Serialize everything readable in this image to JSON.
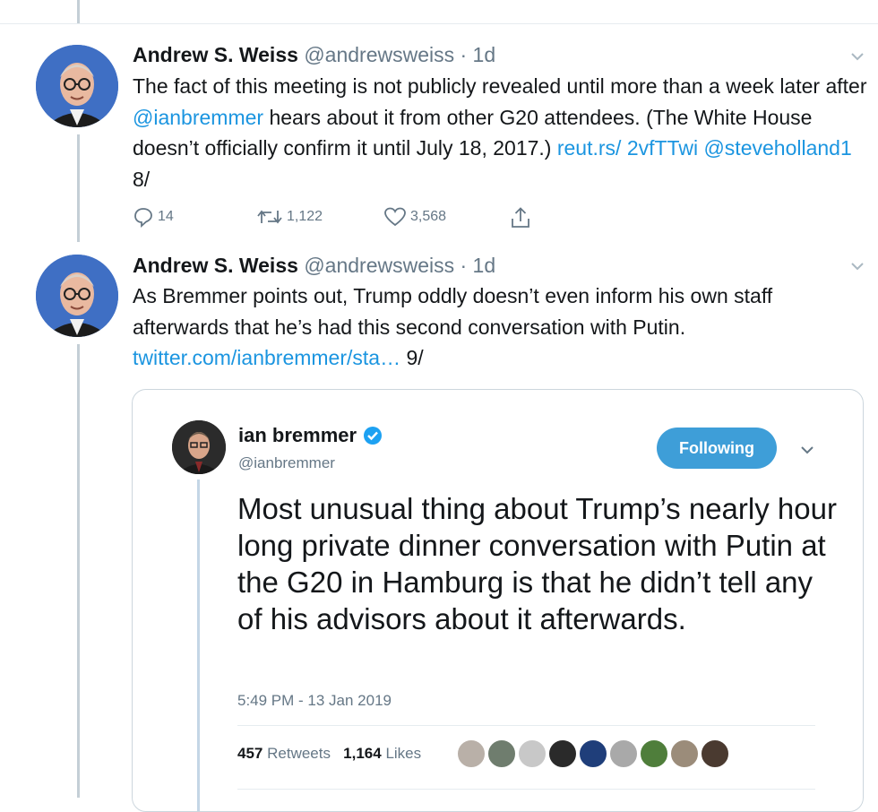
{
  "tweets": [
    {
      "name": "Andrew S. Weiss",
      "handle": "@andrewsweiss",
      "time": "· 1d",
      "text_parts": [
        {
          "t": "The fact of this meeting is not publicly revealed until more than a week later after "
        },
        {
          "t": "@ianbremmer",
          "link": true
        },
        {
          "t": " hears about it from other G20 attendees. (The White House doesn’t officially confirm it until July 18, 2017.) "
        },
        {
          "t": "reut.rs/ 2vfTTwi",
          "link": true
        },
        {
          "t": " "
        },
        {
          "t": "@steveholland1",
          "link": true
        },
        {
          "t": " 8/"
        }
      ],
      "replies": "14",
      "retweets": "1,122",
      "likes": "3,568"
    },
    {
      "name": "Andrew S. Weiss",
      "handle": "@andrewsweiss",
      "time": "· 1d",
      "text_parts": [
        {
          "t": "As Bremmer points out, Trump oddly doesn’t even inform his own staff afterwards that he’s had this second conversation with Putin. "
        },
        {
          "t": "twitter.com/ianbremmer/sta…",
          "link": true
        },
        {
          "t": " 9/"
        }
      ]
    }
  ],
  "quoted": {
    "name": "ian bremmer",
    "handle": "@ianbremmer",
    "follow_label": "Following",
    "text": "Most unusual thing about Trump’s nearly hour long private dinner conversation with Putin at the G20 in Hamburg is that he didn’t tell any of his advisors about it afterwards.",
    "time": "5:49 PM - 13 Jan 2019",
    "retweets_count": "457",
    "retweets_label": "Retweets",
    "likes_count": "1,164",
    "likes_label": "Likes",
    "liker_colors": [
      "#b9b0a8",
      "#6f7d6e",
      "#c8c8c8",
      "#2a2a2a",
      "#1f3e7a",
      "#a9a9a9",
      "#4f7e3b",
      "#9b8c7a",
      "#4a3a30"
    ]
  },
  "colors": {
    "link": "#1b95e0",
    "follow_button": "#3e9ed8",
    "thread_line": "#c4cfd6"
  }
}
